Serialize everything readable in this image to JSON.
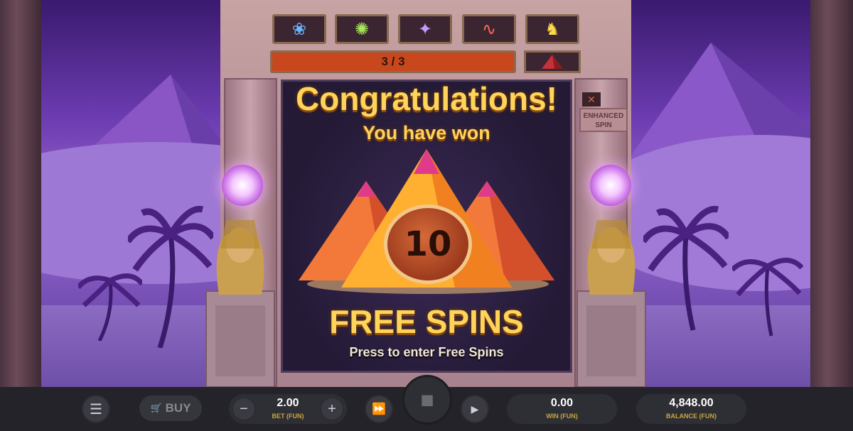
{
  "scene": {
    "symbols": [
      {
        "icon": "lotus-icon",
        "glyph": "❀",
        "color": "#6ab6ff"
      },
      {
        "icon": "scarab-icon",
        "glyph": "✺",
        "color": "#a8e85a"
      },
      {
        "icon": "scorpion-icon",
        "glyph": "✦",
        "color": "#c49aff"
      },
      {
        "icon": "snake-icon",
        "glyph": "∿",
        "color": "#ff6a5a"
      },
      {
        "icon": "sphinx-icon",
        "glyph": "♞",
        "color": "#ffd94a"
      }
    ],
    "progress_text": "3 / 3",
    "enhanced_label": "ENHANCED SPIN",
    "enhanced_close_glyph": "✕"
  },
  "popup": {
    "title": "Congratulations!",
    "subtitle": "You have won",
    "count": "10",
    "prize": "FREE SPINS",
    "prompt": "Press to enter Free Spins"
  },
  "controls": {
    "menu_glyph": "☰",
    "buy_label": "BUY",
    "minus_glyph": "−",
    "plus_glyph": "+",
    "bet_value": "2.00",
    "bet_label": "BET (FUN)",
    "fast_glyph": "⏩",
    "stop_glyph": "■",
    "auto_glyph": "▶",
    "win_value": "0.00",
    "win_label": "WIN (FUN)",
    "balance_value": "4,848.00",
    "balance_label": "BALANCE (FUN)"
  }
}
